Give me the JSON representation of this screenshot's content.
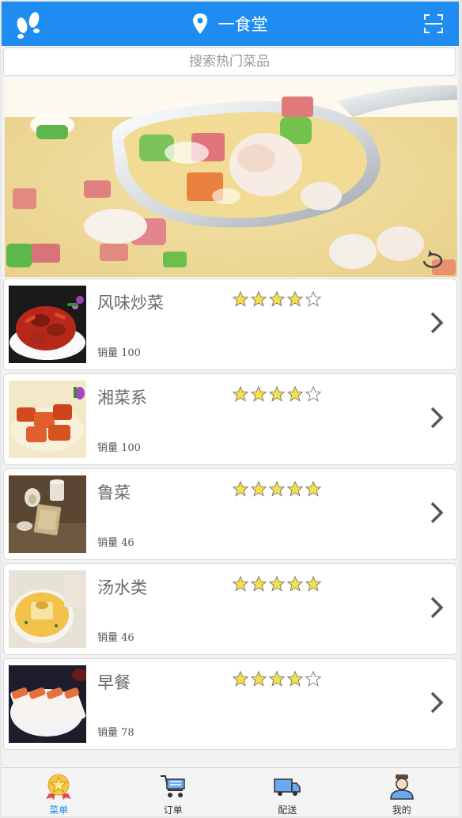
{
  "header": {
    "title": "一食堂",
    "left_icon": "footprints-icon",
    "pin_icon": "location-pin-icon",
    "right_icon": "scan-icon"
  },
  "search": {
    "placeholder": "搜索热门菜品"
  },
  "banner": {
    "subject": "fried-rice-photo",
    "icon": "refresh-icon"
  },
  "categories": [
    {
      "name": "风味炒菜",
      "sales": "销量 100",
      "rating": 4
    },
    {
      "name": "湘菜系",
      "sales": "销量 100",
      "rating": 4
    },
    {
      "name": "鲁菜",
      "sales": "销量 46",
      "rating": 5
    },
    {
      "name": "汤水类",
      "sales": "销量 46",
      "rating": 5
    },
    {
      "name": "早餐",
      "sales": "销量 78",
      "rating": 4
    }
  ],
  "tabs": [
    {
      "label": "菜单",
      "icon": "star-badge-icon",
      "active": true
    },
    {
      "label": "订单",
      "icon": "cart-icon",
      "active": false
    },
    {
      "label": "配送",
      "icon": "delivery-truck-icon",
      "active": false
    },
    {
      "label": "我的",
      "icon": "user-icon",
      "active": false
    }
  ],
  "colors": {
    "header": "#1e8cf0",
    "star": "#f5e04a",
    "active_tab": "#1e8cf0"
  }
}
